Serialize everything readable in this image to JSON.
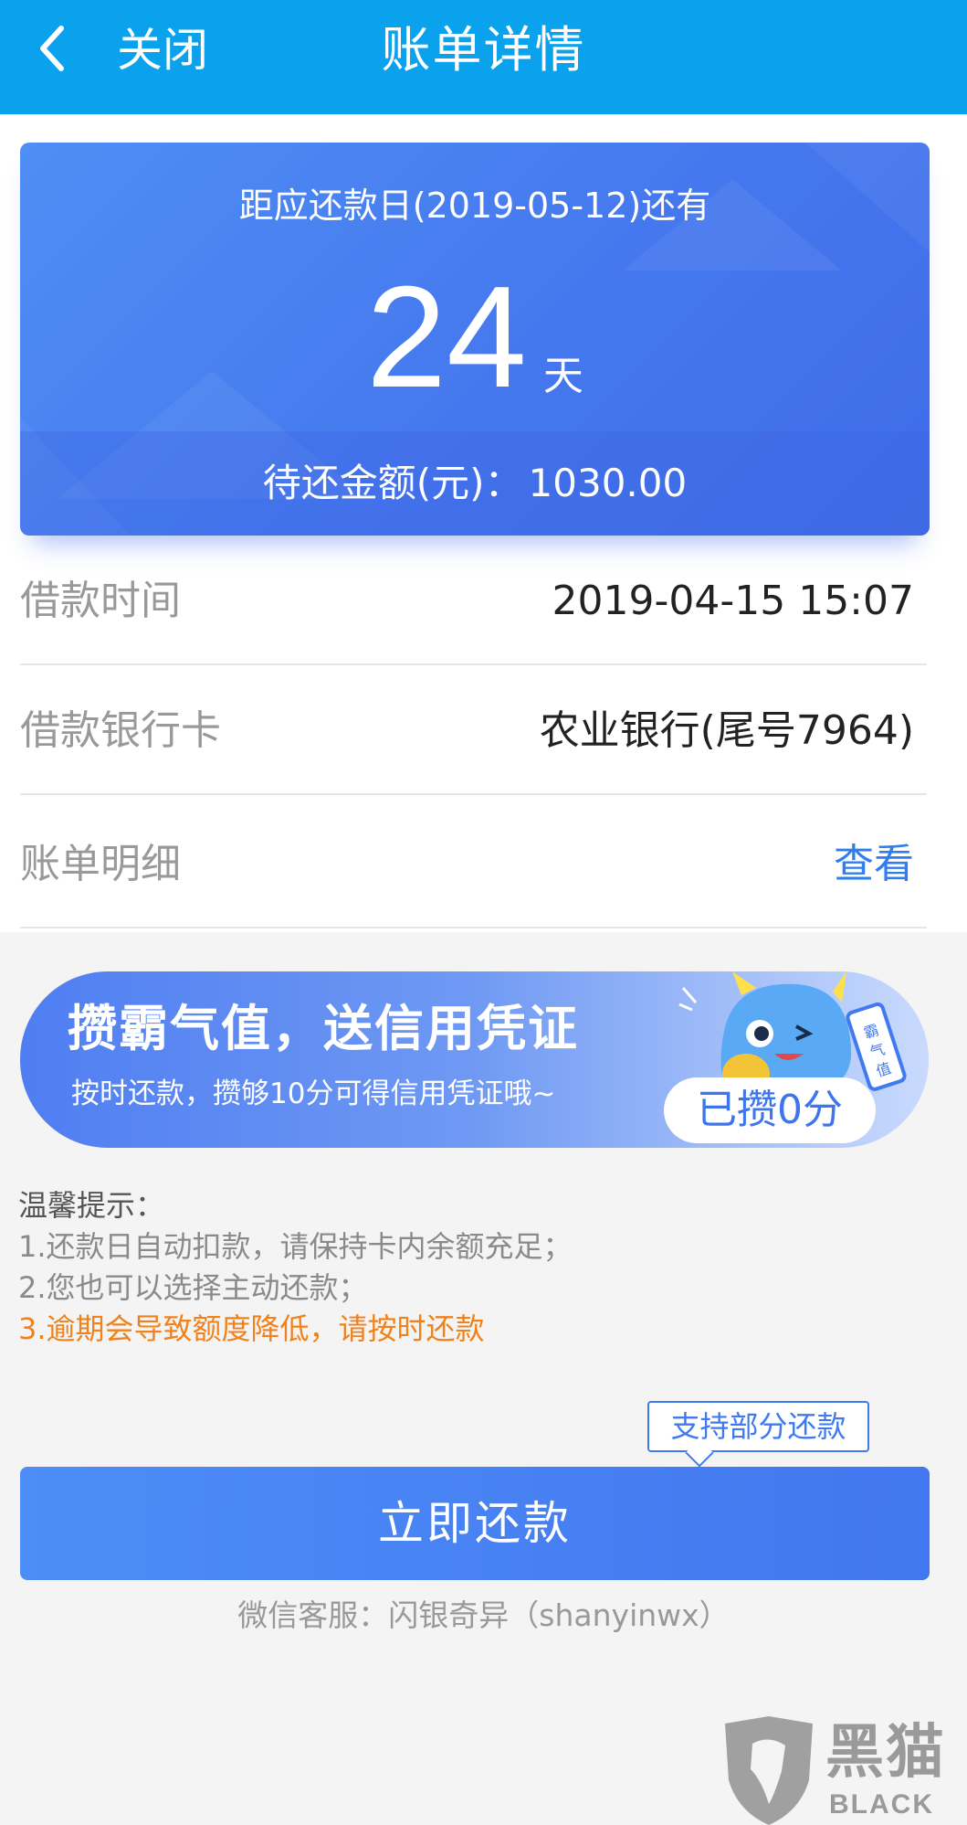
{
  "header": {
    "close_label": "关闭",
    "title": "账单详情"
  },
  "due_card": {
    "label": "距应还款日(2019-05-12)还有",
    "days": "24",
    "days_unit": "天",
    "amount_label": "待还金额(元)：",
    "amount_value": "1030.00"
  },
  "info_rows": [
    {
      "label": "借款时间",
      "value": "2019-04-15 15:07"
    },
    {
      "label": "借款银行卡",
      "value": "农业银行(尾号7964)"
    },
    {
      "label": "账单明细",
      "value": "查看"
    }
  ],
  "banner": {
    "title": "攒霸气值，送信用凭证",
    "subtitle": "按时还款，攒够10分可得信用凭证哦~",
    "score": "已攒0分",
    "phone_text": "霸气值"
  },
  "tips": {
    "title": "温馨提示：",
    "items": [
      "1.还款日自动扣款，请保持卡内余额充足；",
      "2.您也可以选择主动还款；",
      "3.逾期会导致额度降低，请按时还款"
    ]
  },
  "tooltip": "支持部分还款",
  "pay_button": "立即还款",
  "service": "微信客服：闪银奇异（shanyinwx）",
  "watermark": {
    "text": "黑猫",
    "sub": "BLACK CAT"
  },
  "colors": {
    "header_bg": "#0aa2ec",
    "accent_blue": "#3f7af0",
    "warning_orange": "#f0821e"
  }
}
